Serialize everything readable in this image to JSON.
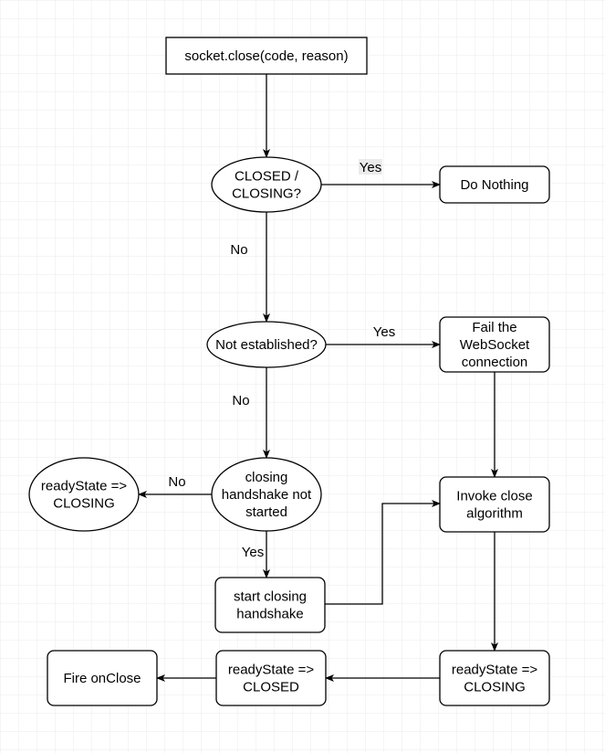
{
  "nodes": {
    "start": {
      "lines": [
        "socket.close(code, reason)"
      ]
    },
    "closed_check": {
      "lines": [
        "CLOSED /",
        "CLOSING?"
      ]
    },
    "do_nothing": {
      "lines": [
        "Do Nothing"
      ]
    },
    "not_established": {
      "lines": [
        "Not established?"
      ]
    },
    "fail": {
      "lines": [
        "Fail the",
        "WebSocket",
        "connection"
      ]
    },
    "handshake_check": {
      "lines": [
        "closing",
        "handshake not",
        "started"
      ]
    },
    "ready_closing_left": {
      "lines": [
        "readyState =>",
        "CLOSING"
      ]
    },
    "start_handshake": {
      "lines": [
        "start closing",
        "handshake"
      ]
    },
    "invoke_close": {
      "lines": [
        "Invoke close",
        "algorithm"
      ]
    },
    "ready_closing": {
      "lines": [
        "readyState =>",
        "CLOSING"
      ]
    },
    "ready_closed": {
      "lines": [
        "readyState =>",
        "CLOSED"
      ]
    },
    "fire_onclose": {
      "lines": [
        "Fire onClose"
      ]
    }
  },
  "edge_labels": {
    "closed_yes": "Yes",
    "closed_no": "No",
    "established_yes": "Yes",
    "established_no": "No",
    "handshake_no": "No",
    "handshake_yes": "Yes"
  },
  "colors": {
    "grid": "#ebebeb",
    "label_highlight": "#ebebeb"
  }
}
